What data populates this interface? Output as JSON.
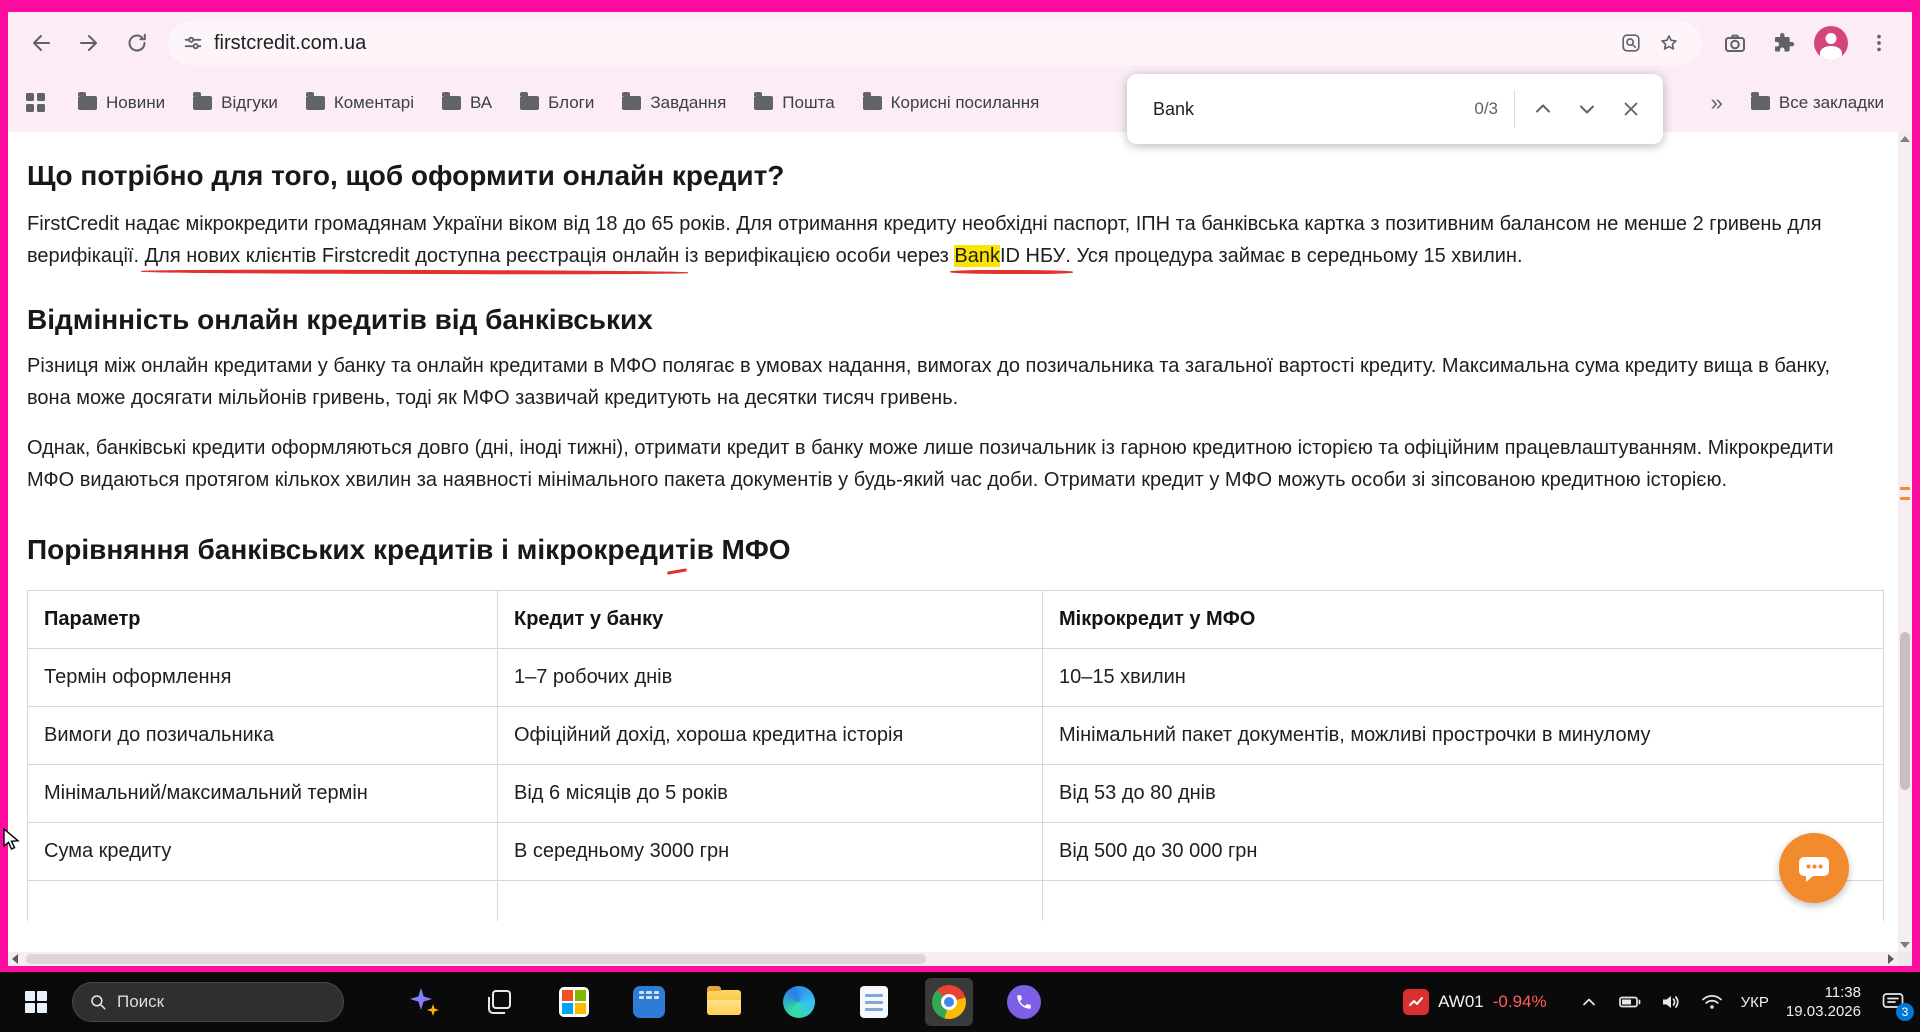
{
  "browser": {
    "url": "firstcredit.com.ua",
    "bookmarks": {
      "items": [
        "Новини",
        "Відгуки",
        "Коментарі",
        "ВА",
        "Блоги",
        "Завдання",
        "Пошта",
        "Корисні посилання"
      ],
      "overflow": "»",
      "all_bookmarks": "Все закладки"
    },
    "find_bar": {
      "query": "Bank",
      "counter": "0/3"
    }
  },
  "page": {
    "heading1": "Що потрібно для того, щоб оформити онлайн кредит?",
    "intro": {
      "seg1": "FirstCredit надає мікрокредити громадянам України віком від 18 до 65 років. Для отримання кредиту необхідні паспорт, ІПН та банківська картка з позитивним балансом не менше 2 гривень для верифікації. ",
      "seg2_underlined": "Для нових клієнтів Firstcredit доступна реєстрація онлайн",
      "seg3": " із верифікацією особи через ",
      "seg4_highlighted": "Bank",
      "seg5_underlined": "ID НБУ",
      "seg6": ". Уся процедура займає в середньому 15 хвилин."
    },
    "heading2": "Відмінність онлайн кредитів від банківських",
    "para2": "Різниця між онлайн кредитами у банку та онлайн кредитами в МФО полягає в умовах надання, вимогах до позичальника та загальної вартості кредиту. Максимальна сума кредиту вища в банку, вона може досягати мільйонів гривень, тоді як МФО зазвичай кредитують на десятки тисяч гривень.",
    "para3": "Однак, банківські кредити оформляються довго (дні, іноді тижні), отримати кредит в банку може лише позичальник із гарною кредитною історією та офіційним працевлаштуванням. Мікрокредити МФО видаються протягом кількох хвилин за наявності мінімального пакета документів у будь-який час доби. Отримати кредит у МФО можуть особи зі зіпсованою кредитною історією.",
    "heading3": "Порівняння банківських кредитів і мікрокредитів МФО",
    "table": {
      "headers": [
        "Параметр",
        "Кредит у банку",
        "Мікрокредит у МФО"
      ],
      "rows": [
        [
          "Термін оформлення",
          "1–7 робочих днів",
          "10–15 хвилин"
        ],
        [
          "Вимоги до позичальника",
          "Офіційний дохід, хороша кредитна історія",
          "Мінімальний пакет документів, можливі прострочки в минулому"
        ],
        [
          "Мінімальний/максимальний термін",
          "Від 6 місяців до 5 років",
          "Від 53 до 80 днів"
        ],
        [
          "Сума кредиту",
          "В середньому 3000 грн",
          "Від 500 до 30 000 грн"
        ]
      ]
    }
  },
  "taskbar": {
    "search_label": "Поиск",
    "stock_symbol": "AW01",
    "stock_change": "-0.94%",
    "language": "УКР",
    "time": "11:38",
    "date": "19.03.2026",
    "notification_count": "3"
  },
  "colors": {
    "window_frame_pink": "#fc0da0",
    "toolbar_background": "#fbecf6",
    "find_highlight_yellow": "#fde300",
    "annotation_red": "#e3322e",
    "chat_button_orange": "#f28a2e",
    "taskbar_black": "#0a0a0a",
    "stock_negative_red": "#ff5b5b"
  }
}
